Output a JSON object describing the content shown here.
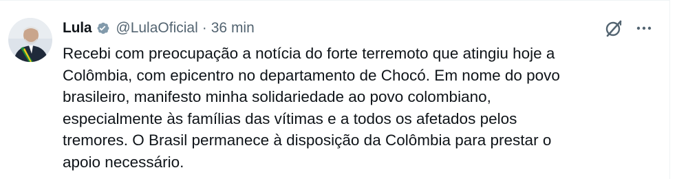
{
  "tweet": {
    "author_name": "Lula",
    "handle": "@LulaOficial",
    "separator": "·",
    "time_ago": "36 min",
    "text": "Recebi com preocupação a notícia do forte terremoto que atingiu hoje a\nColômbia, com epicentro no departamento de Chocó. Em nome do povo\nbrasileiro, manifesto minha solidariedade ao povo colombiano,\nespecialmente às famílias das vítimas e a todos os afetados pelos\ntremores. O Brasil permanece à disposição da Colômbia para prestar o\napoio necessário."
  },
  "icons": {
    "verified": "verified-badge-icon",
    "grok": "grok-icon",
    "more": "more-options-icon"
  },
  "colors": {
    "text_primary": "#0f1419",
    "text_secondary": "#536471",
    "verified_badge": "#829aab",
    "border": "#eff3f4"
  }
}
